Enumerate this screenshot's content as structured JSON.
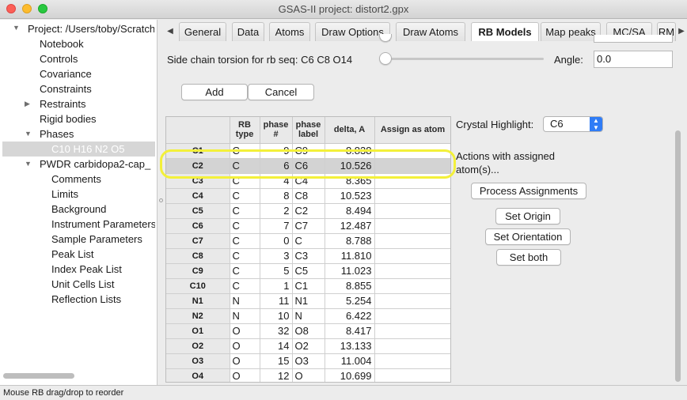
{
  "window": {
    "title": "GSAS-II project: distort2.gpx"
  },
  "tree": {
    "items": [
      {
        "label": "Project: /Users/toby/Scratch",
        "arrow": "▼"
      },
      {
        "label": "Notebook"
      },
      {
        "label": "Controls"
      },
      {
        "label": "Covariance"
      },
      {
        "label": "Constraints"
      },
      {
        "label": "Restraints",
        "arrow": "▶"
      },
      {
        "label": "Rigid bodies"
      },
      {
        "label": "Phases",
        "arrow": "▼"
      },
      {
        "label": "C10 H16 N2 O5"
      },
      {
        "label": "PWDR carbidopa2-cap_",
        "arrow": "▼"
      },
      {
        "label": "Comments"
      },
      {
        "label": "Limits"
      },
      {
        "label": "Background"
      },
      {
        "label": "Instrument Parameters"
      },
      {
        "label": "Sample Parameters"
      },
      {
        "label": "Peak List"
      },
      {
        "label": "Index Peak List"
      },
      {
        "label": "Unit Cells List"
      },
      {
        "label": "Reflection Lists"
      }
    ]
  },
  "tabs": {
    "left_arrow": "◀",
    "right_arrow": "▶",
    "items": [
      "General",
      "Data",
      "Atoms",
      "Draw Options",
      "Draw Atoms",
      "RB Models",
      "Map peaks",
      "MC/SA",
      "RM"
    ],
    "active": "RB Models"
  },
  "panel": {
    "torsion_label": "Side chain torsion for rb seq: C6 C8 O14",
    "angle_label": "Angle:",
    "angle_value": "0.0",
    "add_button": "Add",
    "cancel_button": "Cancel",
    "crystal_highlight_label": "Crystal Highlight:",
    "crystal_highlight_value": "C6",
    "actions_text": "Actions with assigned atom(s)...",
    "process_button": "Process Assignments",
    "set_origin_button": "Set Origin",
    "set_orientation_button": "Set Orientation",
    "set_both_button": "Set both"
  },
  "grid": {
    "headers": [
      "",
      "RB type",
      "phase #",
      "phase label",
      "delta, A",
      "Assign as atom"
    ],
    "rows": [
      {
        "label": "C1",
        "type": "C",
        "num": "9",
        "plabel": "C9",
        "delta": "8.838"
      },
      {
        "label": "C2",
        "type": "C",
        "num": "6",
        "plabel": "C6",
        "delta": "10.526"
      },
      {
        "label": "C3",
        "type": "C",
        "num": "4",
        "plabel": "C4",
        "delta": "8.365"
      },
      {
        "label": "C4",
        "type": "C",
        "num": "8",
        "plabel": "C8",
        "delta": "10.523"
      },
      {
        "label": "C5",
        "type": "C",
        "num": "2",
        "plabel": "C2",
        "delta": "8.494"
      },
      {
        "label": "C6",
        "type": "C",
        "num": "7",
        "plabel": "C7",
        "delta": "12.487"
      },
      {
        "label": "C7",
        "type": "C",
        "num": "0",
        "plabel": "C",
        "delta": "8.788"
      },
      {
        "label": "C8",
        "type": "C",
        "num": "3",
        "plabel": "C3",
        "delta": "11.810"
      },
      {
        "label": "C9",
        "type": "C",
        "num": "5",
        "plabel": "C5",
        "delta": "11.023"
      },
      {
        "label": "C10",
        "type": "C",
        "num": "1",
        "plabel": "C1",
        "delta": "8.855"
      },
      {
        "label": "N1",
        "type": "N",
        "num": "11",
        "plabel": "N1",
        "delta": "5.254"
      },
      {
        "label": "N2",
        "type": "N",
        "num": "10",
        "plabel": "N",
        "delta": "6.422"
      },
      {
        "label": "O1",
        "type": "O",
        "num": "32",
        "plabel": "O8",
        "delta": "8.417"
      },
      {
        "label": "O2",
        "type": "O",
        "num": "14",
        "plabel": "O2",
        "delta": "13.133"
      },
      {
        "label": "O3",
        "type": "O",
        "num": "15",
        "plabel": "O3",
        "delta": "11.004"
      },
      {
        "label": "O4",
        "type": "O",
        "num": "12",
        "plabel": "O",
        "delta": "10.699"
      }
    ],
    "highlighted_row": "C2"
  },
  "status": {
    "text": "Mouse RB drag/drop to reorder"
  },
  "colors": {
    "accent": "#2f7cf6",
    "ring": "#f3f03a"
  }
}
